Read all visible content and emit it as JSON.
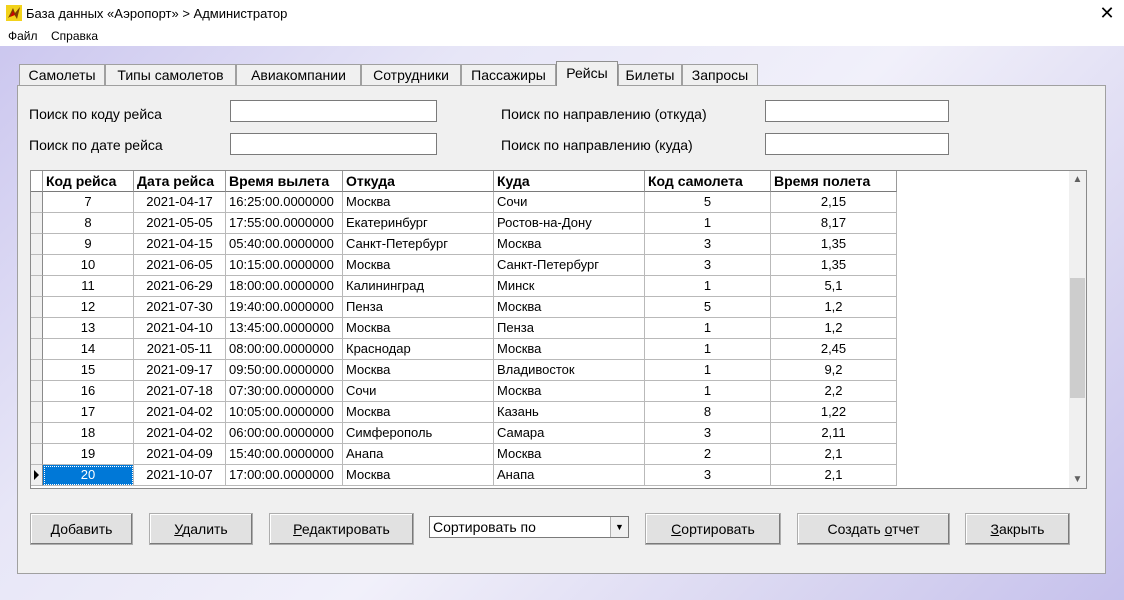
{
  "window": {
    "title": "База данных «Аэропорт» > Администратор"
  },
  "menu": {
    "file": "Файл",
    "help": "Справка"
  },
  "tabs": [
    "Самолеты",
    "Типы самолетов",
    "Авиакомпании",
    "Сотрудники",
    "Пассажиры",
    "Рейсы",
    "Билеты",
    "Запросы"
  ],
  "active_tab": "Рейсы",
  "search": {
    "by_code_label": "Поиск по коду рейса",
    "by_date_label": "Поиск по дате рейса",
    "by_from_label": "Поиск по направлению (откуда)",
    "by_to_label": "Поиск по направлению (куда)",
    "by_code_value": "",
    "by_date_value": "",
    "by_from_value": "",
    "by_to_value": ""
  },
  "grid": {
    "columns": [
      "Код рейса",
      "Дата рейса",
      "Время вылета",
      "Откуда",
      "Куда",
      "Код самолета",
      "Время полета"
    ],
    "rows": [
      [
        "7",
        "2021-04-17",
        "16:25:00.0000000",
        "Москва",
        "Сочи",
        "5",
        "2,15"
      ],
      [
        "8",
        "2021-05-05",
        "17:55:00.0000000",
        "Екатеринбург",
        "Ростов-на-Дону",
        "1",
        "8,17"
      ],
      [
        "9",
        "2021-04-15",
        "05:40:00.0000000",
        "Санкт-Петербург",
        "Москва",
        "3",
        "1,35"
      ],
      [
        "10",
        "2021-06-05",
        "10:15:00.0000000",
        "Москва",
        "Санкт-Петербург",
        "3",
        "1,35"
      ],
      [
        "11",
        "2021-06-29",
        "18:00:00.0000000",
        "Калининград",
        "Минск",
        "1",
        "5,1"
      ],
      [
        "12",
        "2021-07-30",
        "19:40:00.0000000",
        "Пенза",
        "Москва",
        "5",
        "1,2"
      ],
      [
        "13",
        "2021-04-10",
        "13:45:00.0000000",
        "Москва",
        "Пенза",
        "1",
        "1,2"
      ],
      [
        "14",
        "2021-05-11",
        "08:00:00.0000000",
        "Краснодар",
        "Москва",
        "1",
        "2,45"
      ],
      [
        "15",
        "2021-09-17",
        "09:50:00.0000000",
        "Москва",
        "Владивосток",
        "1",
        "9,2"
      ],
      [
        "16",
        "2021-07-18",
        "07:30:00.0000000",
        "Сочи",
        "Москва",
        "1",
        "2,2"
      ],
      [
        "17",
        "2021-04-02",
        "10:05:00.0000000",
        "Москва",
        "Казань",
        "8",
        "1,22"
      ],
      [
        "18",
        "2021-04-02",
        "06:00:00.0000000",
        "Симферополь",
        "Самара",
        "3",
        "2,11"
      ],
      [
        "19",
        "2021-04-09",
        "15:40:00.0000000",
        "Анапа",
        "Москва",
        "2",
        "2,1"
      ],
      [
        "20",
        "2021-10-07",
        "17:00:00.0000000",
        "Москва",
        "Анапа",
        "3",
        "2,1"
      ]
    ],
    "selected_row": 13,
    "scroll_position": 0.55
  },
  "buttons": {
    "add": "Добавить",
    "delete": "Удалить",
    "edit": "Редактировать",
    "sort": "Сортировать",
    "report": "Создать отчет",
    "close": "Закрыть"
  },
  "sort_combo": {
    "value": "Сортировать по"
  },
  "colors": {
    "selection": "#0078d7",
    "panel": "#f0f0f0"
  }
}
